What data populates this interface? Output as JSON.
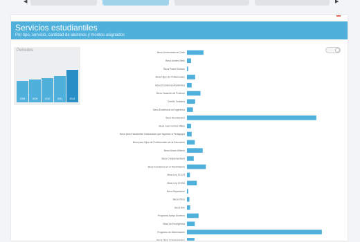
{
  "tabs": [
    {
      "label": "",
      "active": false
    },
    {
      "label": "",
      "active": true
    },
    {
      "label": "",
      "active": false
    },
    {
      "label": "",
      "active": false
    }
  ],
  "nav": {
    "left_icon": "chevron-left-icon",
    "right_icon": "chevron-right-icon",
    "left_glyph": "◀",
    "right_glyph": "▶"
  },
  "panel": {
    "title": "Servicios estudiantiles",
    "subtitle": "Por tipo, servicio, cantidad de alumnos y montos asignados",
    "update_note": "",
    "download_label": "",
    "toggle_label": ""
  },
  "periods": {
    "title": "Períodos",
    "subtitle": "",
    "years": [
      "2008",
      "2009",
      "2010",
      "2011",
      "2012"
    ],
    "heights": [
      0.52,
      0.55,
      0.58,
      0.63,
      0.78
    ],
    "selected": "2012"
  },
  "colors": {
    "accent": "#4fb0dc",
    "accent_dark": "#2b8fc7",
    "tab_active": "#9fd3ea",
    "download": "#e3625a"
  },
  "chart_data": {
    "type": "bar",
    "orientation": "horizontal",
    "categories": [
      "Beca Universidad de Chile",
      "Beca Andrés Bello",
      "Beca Padre Hurtado",
      "Beca Hijos de Profesionales",
      "Beca Excelencia Académica",
      "Beca Vocación de Profesor",
      "Crédito Solidario",
      "Beca Excelencia en Ingeniería",
      "Beca Bicentenario",
      "Beca Juan Gómez Millas",
      "Beca para Estudiantes Destacados que Ingresan a Pedagogía",
      "Beca para Hijos de Profesionales de la Educación",
      "Beca Nuevo Milenio",
      "Beca Complementaria",
      "Beca Excelencia en el Rendimiento",
      "Beca Ley 19.123",
      "Beca Ley 19.992",
      "Beca Reparación",
      "Beca Otros",
      "Beca Arte",
      "Programa Apoyo Alumnos",
      "Beca de Emergencia",
      "Programa de Alimentación",
      "Beca Otros Complementos"
    ],
    "values": [
      1050,
      260,
      65,
      520,
      300,
      860,
      520,
      380,
      8200,
      260,
      300,
      500,
      1000,
      430,
      1200,
      190,
      630,
      80,
      160,
      210,
      740,
      500,
      8550,
      480
    ],
    "value_labels": [
      "",
      "",
      "",
      "",
      "",
      "",
      "",
      "",
      "",
      "",
      "",
      "",
      "",
      "",
      "",
      "",
      "",
      "",
      "",
      "",
      "",
      "",
      "",
      ""
    ],
    "xlim": [
      0,
      8600
    ],
    "grid": false,
    "title": "",
    "xlabel": "",
    "ylabel": ""
  }
}
